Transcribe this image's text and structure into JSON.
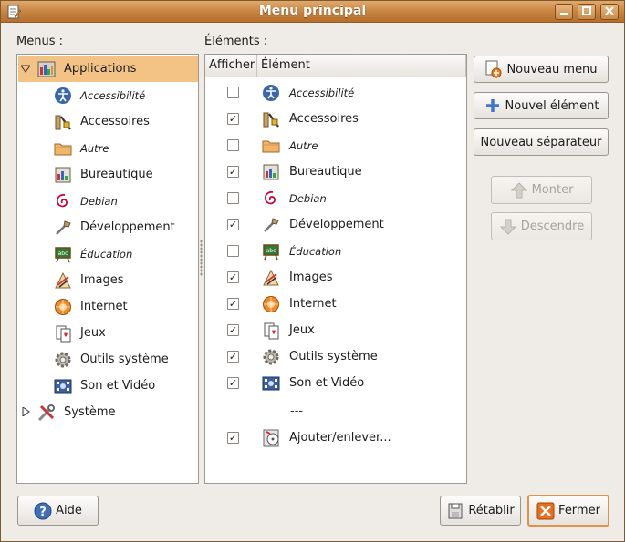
{
  "window": {
    "title": "Menu principal"
  },
  "labels": {
    "menus": "Menus :",
    "elements": "Éléments :"
  },
  "columns": {
    "show": "Afficher",
    "element": "Élément"
  },
  "menus": {
    "root_label": "Applications",
    "children": [
      {
        "label": "Accessibilité",
        "icon": "accessibility-icon",
        "italic": true
      },
      {
        "label": "Accessoires",
        "icon": "accessories-icon",
        "italic": false
      },
      {
        "label": "Autre",
        "icon": "folder-icon",
        "italic": true
      },
      {
        "label": "Bureautique",
        "icon": "office-icon",
        "italic": false
      },
      {
        "label": "Debian",
        "icon": "debian-icon",
        "italic": true
      },
      {
        "label": "Développement",
        "icon": "development-icon",
        "italic": false
      },
      {
        "label": "Éducation",
        "icon": "education-icon",
        "italic": true
      },
      {
        "label": "Images",
        "icon": "graphics-icon",
        "italic": false
      },
      {
        "label": "Internet",
        "icon": "internet-icon",
        "italic": false
      },
      {
        "label": "Jeux",
        "icon": "games-icon",
        "italic": false
      },
      {
        "label": "Outils système",
        "icon": "system-tools-icon",
        "italic": false
      },
      {
        "label": "Son et Vidéo",
        "icon": "multimedia-icon",
        "italic": false
      }
    ],
    "system_label": "Système"
  },
  "elements": [
    {
      "label": "Accessibilité",
      "checked": false,
      "italic": true,
      "icon": "accessibility-icon"
    },
    {
      "label": "Accessoires",
      "checked": true,
      "italic": false,
      "icon": "accessories-icon"
    },
    {
      "label": "Autre",
      "checked": false,
      "italic": true,
      "icon": "folder-icon"
    },
    {
      "label": "Bureautique",
      "checked": true,
      "italic": false,
      "icon": "office-icon"
    },
    {
      "label": "Debian",
      "checked": false,
      "italic": true,
      "icon": "debian-icon"
    },
    {
      "label": "Développement",
      "checked": true,
      "italic": false,
      "icon": "development-icon"
    },
    {
      "label": "Éducation",
      "checked": false,
      "italic": true,
      "icon": "education-icon"
    },
    {
      "label": "Images",
      "checked": true,
      "italic": false,
      "icon": "graphics-icon"
    },
    {
      "label": "Internet",
      "checked": true,
      "italic": false,
      "icon": "internet-icon"
    },
    {
      "label": "Jeux",
      "checked": true,
      "italic": false,
      "icon": "games-icon"
    },
    {
      "label": "Outils système",
      "checked": true,
      "italic": false,
      "icon": "system-tools-icon"
    },
    {
      "label": "Son et Vidéo",
      "checked": true,
      "italic": false,
      "icon": "multimedia-icon"
    }
  ],
  "separator_text": "---",
  "last_element": {
    "label": "Ajouter/enlever...",
    "checked": true,
    "icon": "add-remove-icon"
  },
  "buttons": {
    "new_menu": "Nouveau menu",
    "new_item": "Nouvel élément",
    "new_separator": "Nouveau séparateur",
    "move_up": "Monter",
    "move_down": "Descendre",
    "help": "Aide",
    "revert": "Rétablir",
    "close": "Fermer"
  },
  "colors": {
    "accent": "#e0914a",
    "selection": "#f2c385",
    "titlebar": "#c8823f"
  }
}
